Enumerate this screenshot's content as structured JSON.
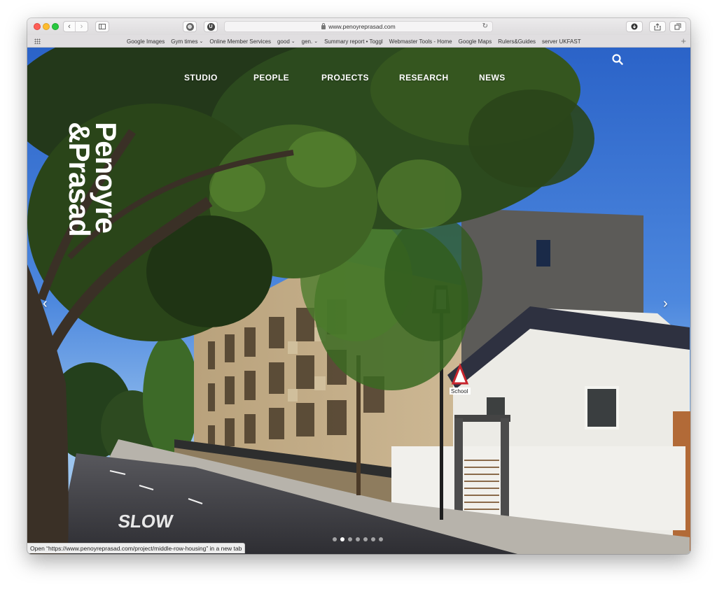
{
  "browser": {
    "url": "www.penoyreprasad.com",
    "bookmarks": [
      {
        "label": "Google Images",
        "dropdown": false
      },
      {
        "label": "Gym times",
        "dropdown": true
      },
      {
        "label": "Online Member Services",
        "dropdown": false
      },
      {
        "label": "good",
        "dropdown": true
      },
      {
        "label": "gen.",
        "dropdown": true
      },
      {
        "label": "Summary report • Toggl",
        "dropdown": false
      },
      {
        "label": "Webmaster Tools - Home",
        "dropdown": false
      },
      {
        "label": "Google Maps",
        "dropdown": false
      },
      {
        "label": "Rulers&Guides",
        "dropdown": false
      },
      {
        "label": "server UKFAST",
        "dropdown": false
      }
    ],
    "status_text": "Open “https://www.penoyreprasad.com/project/middle-row-housing” in a new tab",
    "icons": [
      "back-icon",
      "forward-icon",
      "sidebar-icon",
      "extension-icon",
      "lock-icon",
      "reload-icon",
      "download-icon",
      "share-icon",
      "tabs-icon",
      "bookmark-grid-icon",
      "add-bookmark-icon"
    ]
  },
  "site": {
    "logo_line1": "Penoyre",
    "logo_line2": "&Prasad",
    "nav": {
      "studio": "STUDIO",
      "people": "PEOPLE",
      "projects": "PROJECTS",
      "research": "RESEARCH",
      "news": "NEWS"
    },
    "road_marking": "SLOW",
    "sign_text": "School",
    "slider": {
      "total_slides": 7,
      "active_slide": 2
    },
    "colors": {
      "nav_text": "#ffffff",
      "sky": "#3f7ad8"
    }
  }
}
